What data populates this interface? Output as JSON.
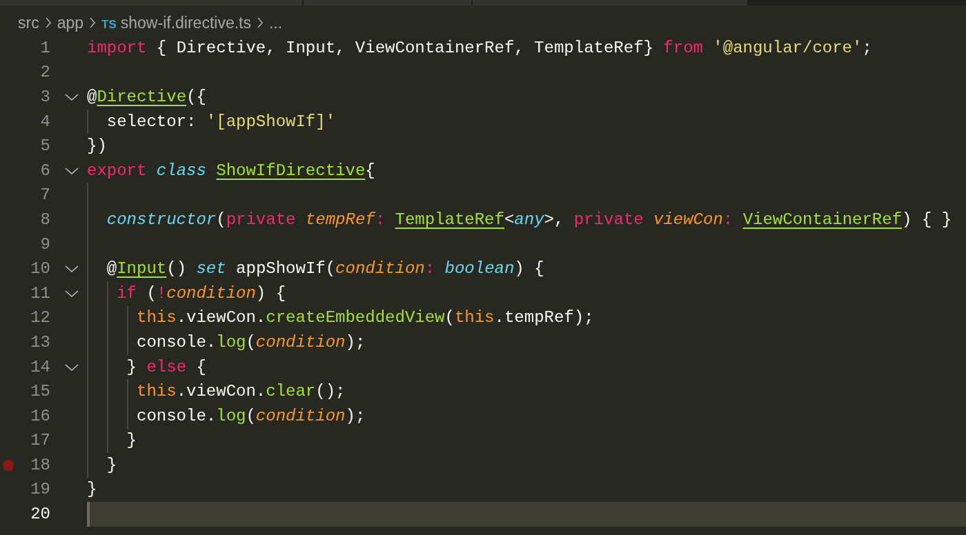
{
  "breadcrumb": {
    "segments": [
      {
        "kind": "folder",
        "label": "src"
      },
      {
        "kind": "folder",
        "label": "app"
      },
      {
        "kind": "file",
        "badge": "TS",
        "label": "show-if.directive.ts"
      },
      {
        "kind": "more",
        "label": "..."
      }
    ]
  },
  "editor": {
    "lines": [
      {
        "number": "1",
        "foldable": false,
        "breakpoint": false,
        "current": false,
        "tokens": [
          {
            "kind": "keyword",
            "text": "import"
          },
          {
            "kind": "plain",
            "text": " { Directive, Input, ViewContainerRef, TemplateRef} "
          },
          {
            "kind": "keyword",
            "text": "from"
          },
          {
            "kind": "string",
            "text": " '@angular/core'"
          },
          {
            "kind": "plain",
            "text": ";"
          }
        ]
      },
      {
        "number": "2",
        "foldable": false,
        "breakpoint": false,
        "current": false
      },
      {
        "number": "3",
        "foldable": true,
        "breakpoint": false,
        "current": false,
        "tokens": [
          {
            "kind": "plain",
            "text": "@"
          },
          {
            "kind": "entity",
            "text": "Directive"
          },
          {
            "kind": "plain",
            "text": "({"
          }
        ]
      },
      {
        "number": "4",
        "foldable": false,
        "breakpoint": false,
        "current": false,
        "tokens": [
          {
            "kind": "plain",
            "text": "  selector: "
          },
          {
            "kind": "string",
            "text": "'[appShowIf]'"
          }
        ]
      },
      {
        "number": "5",
        "foldable": false,
        "breakpoint": false,
        "current": false,
        "tokens": [
          {
            "kind": "plain",
            "text": "})"
          }
        ]
      },
      {
        "number": "6",
        "foldable": true,
        "breakpoint": false,
        "current": false,
        "tokens": [
          {
            "kind": "keyword",
            "text": "export"
          },
          {
            "kind": "storage",
            "text": " class "
          },
          {
            "kind": "entity",
            "text": "ShowIfDirective"
          },
          {
            "kind": "plain",
            "text": "{"
          }
        ]
      },
      {
        "number": "7",
        "foldable": false,
        "breakpoint": false,
        "current": false
      },
      {
        "number": "8",
        "foldable": false,
        "breakpoint": false,
        "current": false,
        "tokens": [
          {
            "kind": "storage",
            "text": "  constructor"
          },
          {
            "kind": "plain",
            "text": "("
          },
          {
            "kind": "keyword",
            "text": "private"
          },
          {
            "kind": "param",
            "text": " tempRef"
          },
          {
            "kind": "keyword",
            "text": ": "
          },
          {
            "kind": "entity",
            "text": "TemplateRef"
          },
          {
            "kind": "plain",
            "text": "<"
          },
          {
            "kind": "storage",
            "text": "any"
          },
          {
            "kind": "plain",
            "text": ">, "
          },
          {
            "kind": "keyword",
            "text": "private"
          },
          {
            "kind": "param",
            "text": " viewCon"
          },
          {
            "kind": "keyword",
            "text": ": "
          },
          {
            "kind": "entity",
            "text": "ViewContainerRef"
          },
          {
            "kind": "plain",
            "text": ") { }"
          }
        ]
      },
      {
        "number": "9",
        "foldable": false,
        "breakpoint": false,
        "current": false
      },
      {
        "number": "10",
        "foldable": true,
        "breakpoint": false,
        "current": false,
        "tokens": [
          {
            "kind": "plain",
            "text": "  @"
          },
          {
            "kind": "entity",
            "text": "Input"
          },
          {
            "kind": "plain",
            "text": "() "
          },
          {
            "kind": "storage",
            "text": "set"
          },
          {
            "kind": "plain",
            "text": " appShowIf("
          },
          {
            "kind": "param",
            "text": "condition"
          },
          {
            "kind": "keyword",
            "text": ":"
          },
          {
            "kind": "storage",
            "text": " boolean"
          },
          {
            "kind": "plain",
            "text": ") {"
          }
        ]
      },
      {
        "number": "11",
        "foldable": true,
        "breakpoint": false,
        "current": false,
        "tokens": [
          {
            "kind": "keyword",
            "text": "   if"
          },
          {
            "kind": "plain",
            "text": " ("
          },
          {
            "kind": "keyword",
            "text": "!"
          },
          {
            "kind": "param",
            "text": "condition"
          },
          {
            "kind": "plain",
            "text": ") {"
          }
        ]
      },
      {
        "number": "12",
        "foldable": false,
        "breakpoint": false,
        "current": false,
        "tokens": [
          {
            "kind": "variable",
            "text": "     this"
          },
          {
            "kind": "plain",
            "text": ".viewCon."
          },
          {
            "kind": "function",
            "text": "createEmbeddedView"
          },
          {
            "kind": "plain",
            "text": "("
          },
          {
            "kind": "variable",
            "text": "this"
          },
          {
            "kind": "plain",
            "text": ".tempRef);"
          }
        ]
      },
      {
        "number": "13",
        "foldable": false,
        "breakpoint": false,
        "current": false,
        "tokens": [
          {
            "kind": "plain",
            "text": "     console."
          },
          {
            "kind": "function",
            "text": "log"
          },
          {
            "kind": "plain",
            "text": "("
          },
          {
            "kind": "param",
            "text": "condition"
          },
          {
            "kind": "plain",
            "text": ");"
          }
        ]
      },
      {
        "number": "14",
        "foldable": true,
        "breakpoint": false,
        "current": false,
        "tokens": [
          {
            "kind": "plain",
            "text": "    } "
          },
          {
            "kind": "keyword",
            "text": "else"
          },
          {
            "kind": "plain",
            "text": " {"
          }
        ]
      },
      {
        "number": "15",
        "foldable": false,
        "breakpoint": false,
        "current": false,
        "tokens": [
          {
            "kind": "variable",
            "text": "     this"
          },
          {
            "kind": "plain",
            "text": ".viewCon."
          },
          {
            "kind": "function",
            "text": "clear"
          },
          {
            "kind": "plain",
            "text": "();"
          }
        ]
      },
      {
        "number": "16",
        "foldable": false,
        "breakpoint": false,
        "current": false,
        "tokens": [
          {
            "kind": "plain",
            "text": "     console."
          },
          {
            "kind": "function",
            "text": "log"
          },
          {
            "kind": "plain",
            "text": "("
          },
          {
            "kind": "param",
            "text": "condition"
          },
          {
            "kind": "plain",
            "text": ");"
          }
        ]
      },
      {
        "number": "17",
        "foldable": false,
        "breakpoint": false,
        "current": false,
        "tokens": [
          {
            "kind": "plain",
            "text": "    }"
          }
        ]
      },
      {
        "number": "18",
        "foldable": false,
        "breakpoint": true,
        "current": false,
        "tokens": [
          {
            "kind": "plain",
            "text": "  }"
          }
        ]
      },
      {
        "number": "19",
        "foldable": false,
        "breakpoint": false,
        "current": false,
        "tokens": [
          {
            "kind": "plain",
            "text": "}"
          }
        ]
      },
      {
        "number": "20",
        "foldable": false,
        "breakpoint": false,
        "current": true
      }
    ]
  }
}
